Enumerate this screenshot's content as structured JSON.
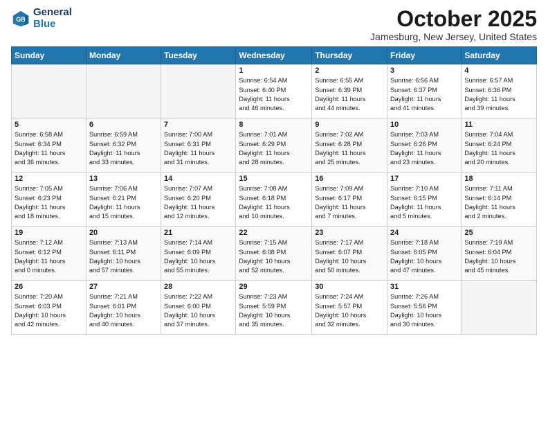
{
  "header": {
    "logo_line1": "General",
    "logo_line2": "Blue",
    "month": "October 2025",
    "location": "Jamesburg, New Jersey, United States"
  },
  "weekdays": [
    "Sunday",
    "Monday",
    "Tuesday",
    "Wednesday",
    "Thursday",
    "Friday",
    "Saturday"
  ],
  "weeks": [
    [
      {
        "day": "",
        "info": ""
      },
      {
        "day": "",
        "info": ""
      },
      {
        "day": "",
        "info": ""
      },
      {
        "day": "1",
        "info": "Sunrise: 6:54 AM\nSunset: 6:40 PM\nDaylight: 11 hours\nand 46 minutes."
      },
      {
        "day": "2",
        "info": "Sunrise: 6:55 AM\nSunset: 6:39 PM\nDaylight: 11 hours\nand 44 minutes."
      },
      {
        "day": "3",
        "info": "Sunrise: 6:56 AM\nSunset: 6:37 PM\nDaylight: 11 hours\nand 41 minutes."
      },
      {
        "day": "4",
        "info": "Sunrise: 6:57 AM\nSunset: 6:36 PM\nDaylight: 11 hours\nand 39 minutes."
      }
    ],
    [
      {
        "day": "5",
        "info": "Sunrise: 6:58 AM\nSunset: 6:34 PM\nDaylight: 11 hours\nand 36 minutes."
      },
      {
        "day": "6",
        "info": "Sunrise: 6:59 AM\nSunset: 6:32 PM\nDaylight: 11 hours\nand 33 minutes."
      },
      {
        "day": "7",
        "info": "Sunrise: 7:00 AM\nSunset: 6:31 PM\nDaylight: 11 hours\nand 31 minutes."
      },
      {
        "day": "8",
        "info": "Sunrise: 7:01 AM\nSunset: 6:29 PM\nDaylight: 11 hours\nand 28 minutes."
      },
      {
        "day": "9",
        "info": "Sunrise: 7:02 AM\nSunset: 6:28 PM\nDaylight: 11 hours\nand 25 minutes."
      },
      {
        "day": "10",
        "info": "Sunrise: 7:03 AM\nSunset: 6:26 PM\nDaylight: 11 hours\nand 23 minutes."
      },
      {
        "day": "11",
        "info": "Sunrise: 7:04 AM\nSunset: 6:24 PM\nDaylight: 11 hours\nand 20 minutes."
      }
    ],
    [
      {
        "day": "12",
        "info": "Sunrise: 7:05 AM\nSunset: 6:23 PM\nDaylight: 11 hours\nand 18 minutes."
      },
      {
        "day": "13",
        "info": "Sunrise: 7:06 AM\nSunset: 6:21 PM\nDaylight: 11 hours\nand 15 minutes."
      },
      {
        "day": "14",
        "info": "Sunrise: 7:07 AM\nSunset: 6:20 PM\nDaylight: 11 hours\nand 12 minutes."
      },
      {
        "day": "15",
        "info": "Sunrise: 7:08 AM\nSunset: 6:18 PM\nDaylight: 11 hours\nand 10 minutes."
      },
      {
        "day": "16",
        "info": "Sunrise: 7:09 AM\nSunset: 6:17 PM\nDaylight: 11 hours\nand 7 minutes."
      },
      {
        "day": "17",
        "info": "Sunrise: 7:10 AM\nSunset: 6:15 PM\nDaylight: 11 hours\nand 5 minutes."
      },
      {
        "day": "18",
        "info": "Sunrise: 7:11 AM\nSunset: 6:14 PM\nDaylight: 11 hours\nand 2 minutes."
      }
    ],
    [
      {
        "day": "19",
        "info": "Sunrise: 7:12 AM\nSunset: 6:12 PM\nDaylight: 11 hours\nand 0 minutes."
      },
      {
        "day": "20",
        "info": "Sunrise: 7:13 AM\nSunset: 6:11 PM\nDaylight: 10 hours\nand 57 minutes."
      },
      {
        "day": "21",
        "info": "Sunrise: 7:14 AM\nSunset: 6:09 PM\nDaylight: 10 hours\nand 55 minutes."
      },
      {
        "day": "22",
        "info": "Sunrise: 7:15 AM\nSunset: 6:08 PM\nDaylight: 10 hours\nand 52 minutes."
      },
      {
        "day": "23",
        "info": "Sunrise: 7:17 AM\nSunset: 6:07 PM\nDaylight: 10 hours\nand 50 minutes."
      },
      {
        "day": "24",
        "info": "Sunrise: 7:18 AM\nSunset: 6:05 PM\nDaylight: 10 hours\nand 47 minutes."
      },
      {
        "day": "25",
        "info": "Sunrise: 7:19 AM\nSunset: 6:04 PM\nDaylight: 10 hours\nand 45 minutes."
      }
    ],
    [
      {
        "day": "26",
        "info": "Sunrise: 7:20 AM\nSunset: 6:03 PM\nDaylight: 10 hours\nand 42 minutes."
      },
      {
        "day": "27",
        "info": "Sunrise: 7:21 AM\nSunset: 6:01 PM\nDaylight: 10 hours\nand 40 minutes."
      },
      {
        "day": "28",
        "info": "Sunrise: 7:22 AM\nSunset: 6:00 PM\nDaylight: 10 hours\nand 37 minutes."
      },
      {
        "day": "29",
        "info": "Sunrise: 7:23 AM\nSunset: 5:59 PM\nDaylight: 10 hours\nand 35 minutes."
      },
      {
        "day": "30",
        "info": "Sunrise: 7:24 AM\nSunset: 5:57 PM\nDaylight: 10 hours\nand 32 minutes."
      },
      {
        "day": "31",
        "info": "Sunrise: 7:26 AM\nSunset: 5:56 PM\nDaylight: 10 hours\nand 30 minutes."
      },
      {
        "day": "",
        "info": ""
      }
    ]
  ]
}
